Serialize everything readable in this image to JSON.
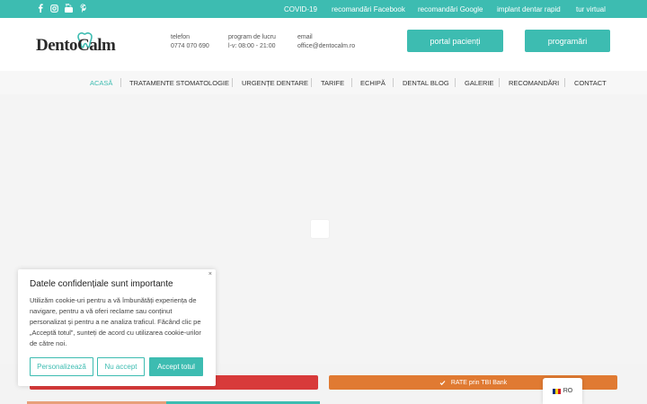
{
  "topbar": {
    "social_icons": [
      "facebook-icon",
      "instagram-icon",
      "youtube-icon",
      "pinterest-icon"
    ],
    "links": [
      "COVID-19",
      "recomandări Facebook",
      "recomandări Google",
      "implant dentar rapid",
      "tur virtual"
    ]
  },
  "header": {
    "logo_text": "DentoCalm",
    "phone_label": "telefon",
    "phone_value": "0774 070 690",
    "hours_label": "program de lucru",
    "hours_value": "l-v: 08:00 - 21:00",
    "email_label": "email",
    "email_value": "office@dentocalm.ro",
    "portal_button": "portal pacienți",
    "appointments_button": "programări"
  },
  "nav": {
    "items": [
      "ACASĂ",
      "TRATAMENTE STOMATOLOGIE",
      "URGENȚE DENTARE",
      "TARIFE",
      "ECHIPĂ",
      "DENTAL BLOG",
      "GALERIE",
      "RECOMANDĂRI",
      "CONTACT"
    ],
    "active_index": 0
  },
  "strips": {
    "rate_label": "RATE prin TBI Bank"
  },
  "cookie": {
    "close": "×",
    "title": "Datele confidențiale sunt importante",
    "body": "Utilizăm cookie-uri pentru a vă îmbunătăți experiența de navigare, pentru a vă oferi reclame sau conținut personalizat și pentru a ne analiza traficul. Făcând clic pe „Acceptă totul”, sunteți de acord cu utilizarea cookie-urilor de către noi.",
    "btn_customize": "Personalizează",
    "btn_reject": "Nu accept",
    "btn_accept": "Accept totul"
  },
  "language": {
    "code": "RO"
  },
  "colors": {
    "accent": "#3dbcb1",
    "red": "#d83a3a",
    "orange": "#e07a32"
  }
}
